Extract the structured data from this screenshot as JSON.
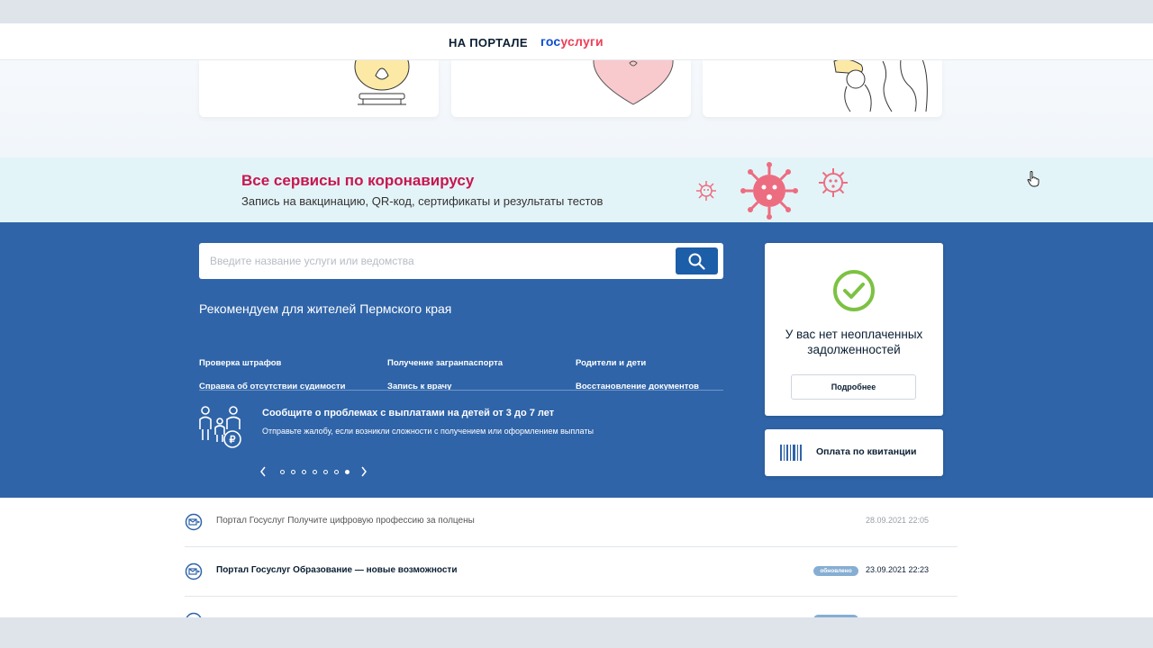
{
  "header": {
    "nav_label": "НА ПОРТАЛЕ",
    "brand_part1": "гос",
    "brand_part2": "услуги"
  },
  "covid": {
    "title": "Все сервисы по коронавирусу",
    "subtitle": "Запись на вакцинацию, QR-код, сертификаты и результаты тестов"
  },
  "search": {
    "placeholder": "Введите название услуги или ведомства"
  },
  "recommend": {
    "title": "Рекомендуем для жителей Пермского края",
    "links": [
      "Проверка штрафов",
      "Получение загранпаспорта",
      "Родители и дети",
      "Справка об отсутствии судимости",
      "Запись к врачу",
      "Восстановление документов"
    ]
  },
  "promo": {
    "title": "Сообщите о проблемах с выплатами на детей от 3 до 7 лет",
    "subtitle": "Отправьте жалобу, если возникли сложности с получением или оформлением выплаты",
    "slides_total": 7,
    "active_slide": 7
  },
  "debt": {
    "message": "У вас нет неоплаченных задолженностей",
    "button": "Подробнее"
  },
  "payment": {
    "label": "Оплата по квитанции"
  },
  "feed": [
    {
      "title": "Портал Госуслуг Получите цифровую профессию за полцены",
      "badge": "",
      "date": "28.09.2021 22:05",
      "read": true
    },
    {
      "title": "Портал Госуслуг Образование — новые возможности",
      "badge": "обновлено",
      "date": "23.09.2021 22:23",
      "read": false
    }
  ],
  "colors": {
    "brand_blue": "#0d4cd3",
    "brand_red": "#ee3f58",
    "covid_title": "#c8164e",
    "section_blue": "#2f64a8",
    "check_green": "#7cc242",
    "badge": "#86aed3"
  },
  "icons": {
    "search": "search-icon",
    "check": "check-circle-icon",
    "barcode": "barcode-icon",
    "feed": "message-icon",
    "family": "family-ruble-icon",
    "virus": "virus-icon"
  }
}
